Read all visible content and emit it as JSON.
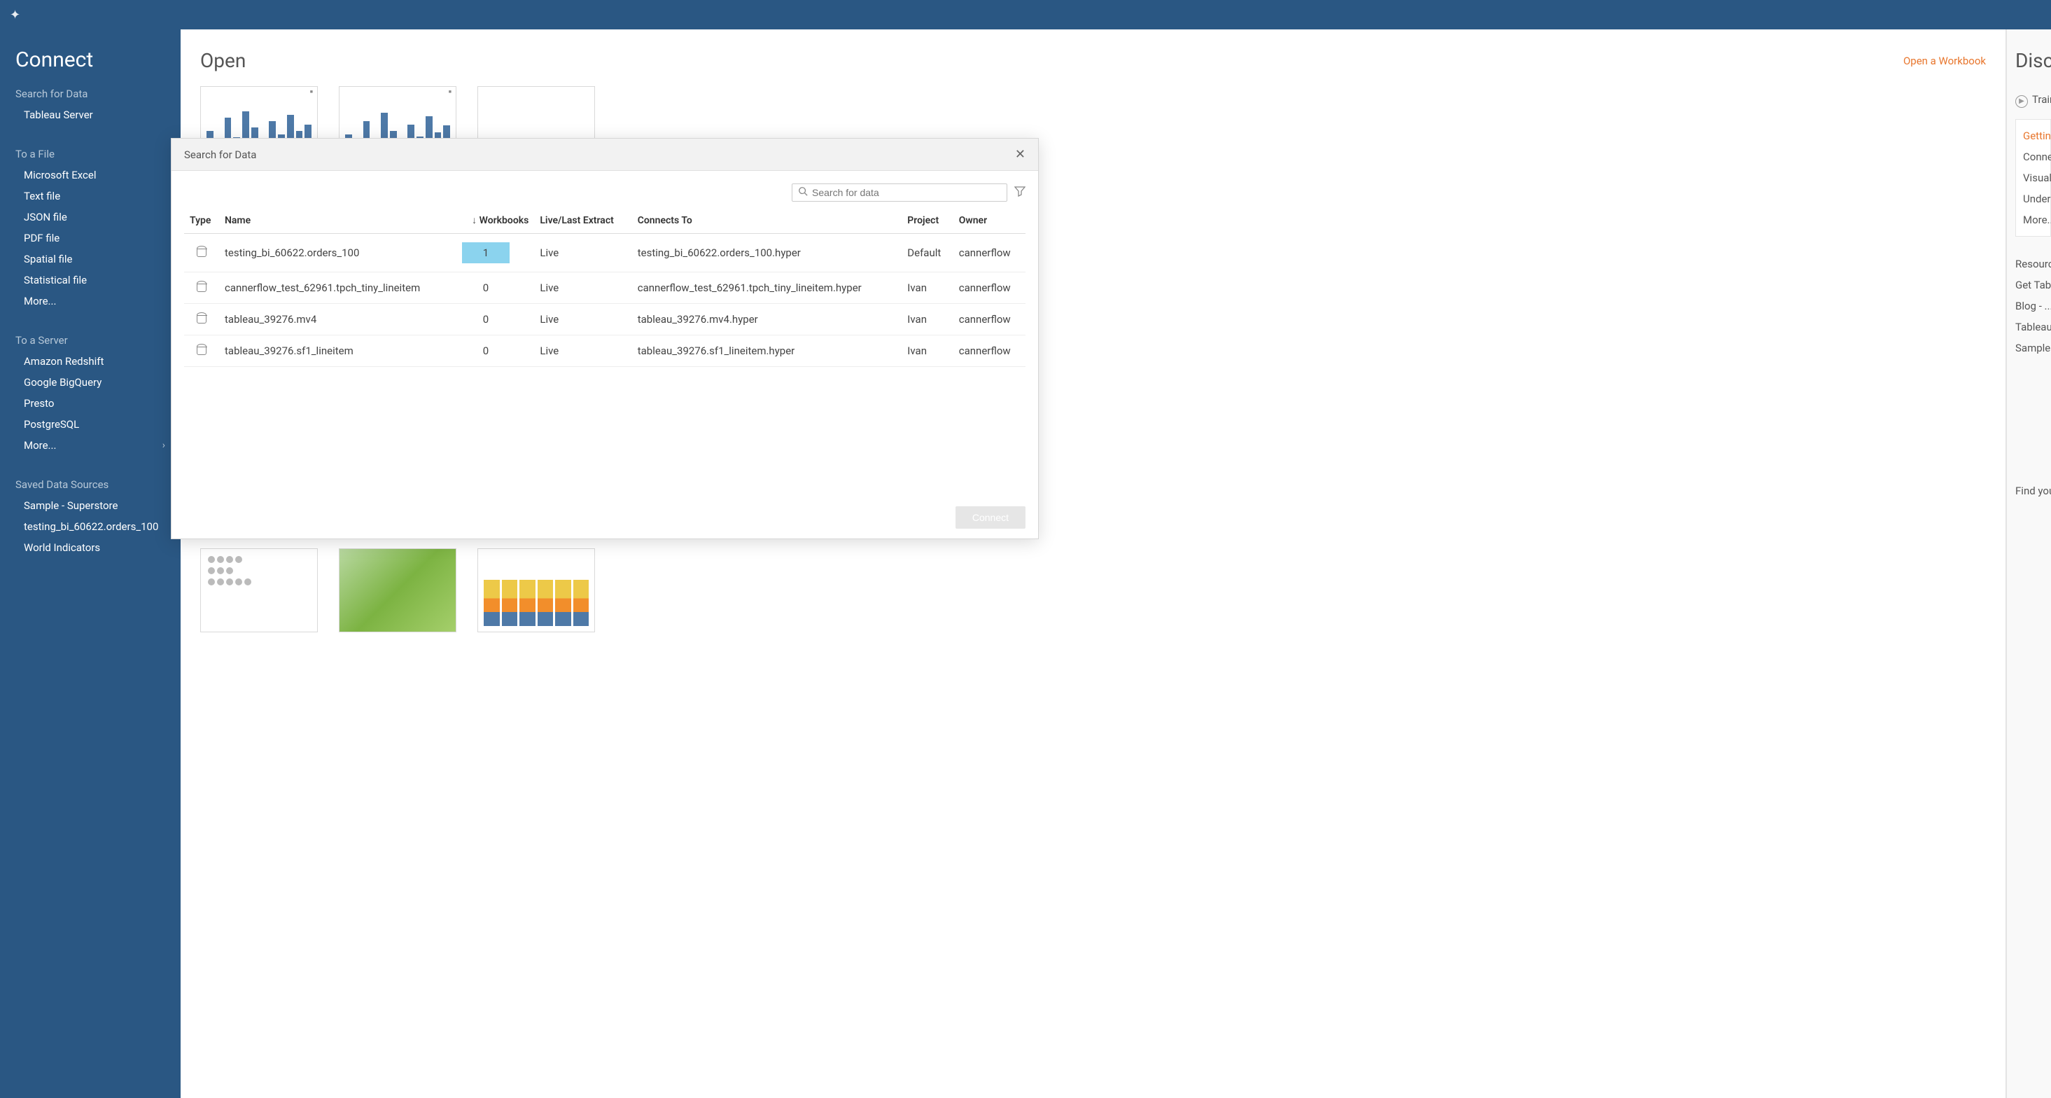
{
  "topbar": {},
  "sidebar": {
    "title": "Connect",
    "search_label": "Search for Data",
    "search_items": [
      "Tableau Server"
    ],
    "file_label": "To a File",
    "file_items": [
      "Microsoft Excel",
      "Text file",
      "JSON file",
      "PDF file",
      "Spatial file",
      "Statistical file",
      "More..."
    ],
    "server_label": "To a Server",
    "server_items": [
      "Amazon Redshift",
      "Google BigQuery",
      "Presto",
      "PostgreSQL",
      "More..."
    ],
    "saved_label": "Saved Data Sources",
    "saved_items": [
      "Sample - Superstore",
      "testing_bi_60622.orders_100",
      "World Indicators"
    ]
  },
  "main": {
    "open_title": "Open",
    "open_workbook_link": "Open a Workbook"
  },
  "right": {
    "title": "Discover",
    "training": "Training",
    "items_top": [
      "Getting Started",
      "Connecting to Data",
      "Visual Analytics",
      "Understanding Tableau",
      "More..."
    ],
    "resources_label": "Resources",
    "items_mid": [
      "Get Tableau Prep",
      "Blog - ...",
      "Tableau Conference",
      "Sample ..."
    ],
    "find_text": "Find your\npath ..."
  },
  "modal": {
    "title": "Search for Data",
    "search_placeholder": "Search for data",
    "columns": [
      "Type",
      "Name",
      "Workbooks",
      "Live/Last Extract",
      "Connects To",
      "Project",
      "Owner"
    ],
    "rows": [
      {
        "name": "testing_bi_60622.orders_100",
        "workbooks": "1",
        "live": "Live",
        "connects": "testing_bi_60622.orders_100.hyper",
        "project": "Default",
        "owner": "cannerflow",
        "highlight": true
      },
      {
        "name": "cannerflow_test_62961.tpch_tiny_lineitem",
        "workbooks": "0",
        "live": "Live",
        "connects": "cannerflow_test_62961.tpch_tiny_lineitem.hyper",
        "project": "Ivan",
        "owner": "cannerflow",
        "highlight": false
      },
      {
        "name": "tableau_39276.mv4",
        "workbooks": "0",
        "live": "Live",
        "connects": "tableau_39276.mv4.hyper",
        "project": "Ivan",
        "owner": "cannerflow",
        "highlight": false
      },
      {
        "name": "tableau_39276.sf1_lineitem",
        "workbooks": "0",
        "live": "Live",
        "connects": "tableau_39276.sf1_lineitem.hyper",
        "project": "Ivan",
        "owner": "cannerflow",
        "highlight": false
      }
    ],
    "connect_button": "Connect"
  }
}
